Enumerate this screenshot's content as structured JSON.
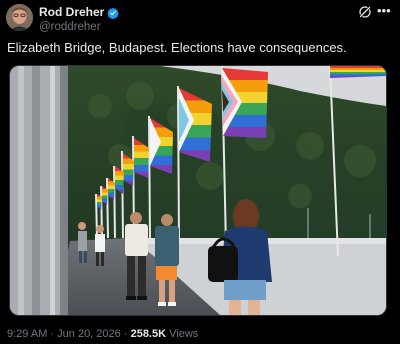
{
  "author": {
    "name": "Rod Dreher",
    "handle": "@roddreher",
    "verified": true,
    "verified_color": "#1d9bf0"
  },
  "post": {
    "text": "Elizabeth Bridge, Budapest. Elections have consequences.",
    "photo": {
      "content": "bridge walkway with pride flags and pedestrians"
    }
  },
  "meta": {
    "time": "9:29 AM",
    "separator": "·",
    "date": "Jun 20, 2026",
    "views_count": "258.5K",
    "views_label": "Views"
  },
  "icons": {
    "grok": "grok-icon",
    "more": "more-options-icon"
  },
  "colors": {
    "background": "#000000",
    "text": "#e7e9ea",
    "muted": "#71767b"
  }
}
